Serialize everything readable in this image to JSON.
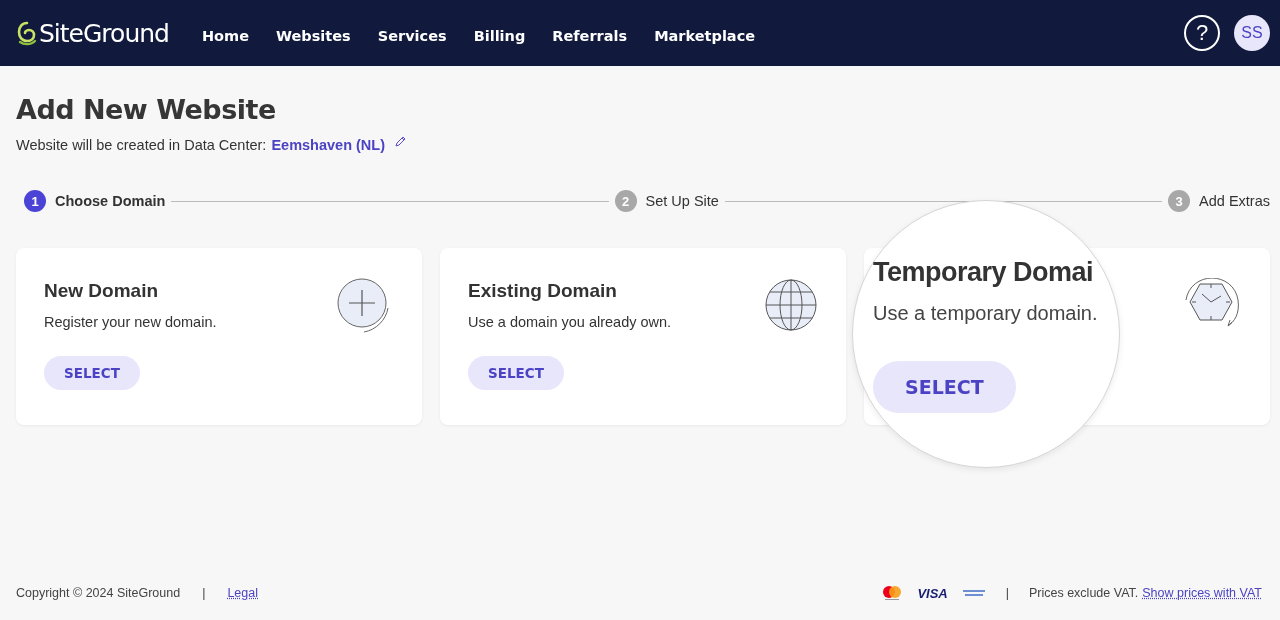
{
  "header": {
    "logo": "SiteGround",
    "nav": [
      {
        "label": "Home"
      },
      {
        "label": "Websites"
      },
      {
        "label": "Services"
      },
      {
        "label": "Billing"
      },
      {
        "label": "Referrals"
      },
      {
        "label": "Marketplace"
      }
    ],
    "help": "?",
    "avatar": "SS"
  },
  "page": {
    "title": "Add New Website",
    "data_center_label": "Website will be created in Data Center:",
    "data_center": "Eemshaven (NL)"
  },
  "steps": [
    {
      "number": "1",
      "label": "Choose Domain",
      "selected": true
    },
    {
      "number": "2",
      "label": "Set Up Site",
      "selected": false
    },
    {
      "number": "3",
      "label": "Add Extras",
      "selected": false
    }
  ],
  "cards": [
    {
      "kind": "plain",
      "title": "New Domain",
      "description": "Register your new domain.",
      "button": "SELECT"
    },
    {
      "kind": "plain",
      "title": "Existing Domain",
      "description": "Use a domain you already own.",
      "button": "SELECT"
    },
    {
      "kind": "magnified",
      "title": "Temporary Domai",
      "description": "Use a temporary domain.",
      "button": "SELECT"
    }
  ],
  "footer": {
    "copyright": "Copyright © 2024 SiteGround",
    "separator": "|",
    "legal": "Legal",
    "visa": "VISA",
    "separator_2": "|",
    "vat_note": "Prices exclude VAT.",
    "vat_link": "Show prices with VAT"
  }
}
